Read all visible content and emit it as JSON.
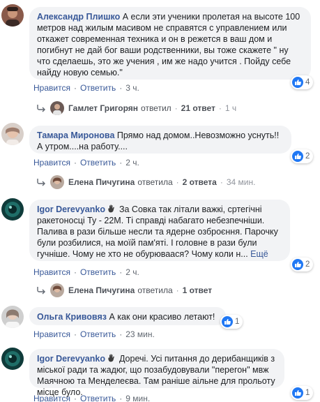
{
  "comments": [
    {
      "author": "Александр Плишко",
      "text": "А если эти ученики пролетая на высоте 100 метров над жилым масивом не справятся с управлением или откажет современная техника и он в режется в ваш дом и погибнут не дай бог ваши родственники, вы тоже скажете \" ну что сделаешь, это же учения , им же надо учится . Пойду себе найду новую семью.\"",
      "like_label": "Нравится",
      "reply_label": "Ответить",
      "time": "3 ч.",
      "reaction_count": "4",
      "replies": {
        "name": "Гамлет Григорян",
        "action": "ответил",
        "count": "21 ответ",
        "time": "1 ч"
      }
    },
    {
      "author": "Тамара Миронова",
      "text": "Прямо над домом..Невозможно уснуть!! А утром....на работу....",
      "like_label": "Нравится",
      "reply_label": "Ответить",
      "time": "2 ч.",
      "reaction_count": "2",
      "replies": {
        "name": "Елена Пичугина",
        "action": "ответила",
        "count": "2 ответа",
        "time": "34 мин."
      }
    },
    {
      "author": "Igor Derevyanko",
      "text": "За Совка так літали важкі, сртегічні ракетоносці Ту - 22М. Ті справді набагато небезпечніши. Палива в рази більше несли та ядерне озброєння. Парочку були розбилися, на моїй пам'яті. І головне в рази були гучніше. Чому не хто не обурюваася? Чому коли н...",
      "more": "Ещё",
      "like_label": "Нравится",
      "reply_label": "Ответить",
      "time": "2 ч.",
      "reaction_count": "2",
      "replies": {
        "name": "Елена Пичугина",
        "action": "ответила",
        "count": "1 ответ",
        "time": ""
      }
    },
    {
      "author": "Ольга Кривовяз",
      "text": "А как они красиво летают!",
      "like_label": "Нравится",
      "reply_label": "Ответить",
      "time": "23 мин.",
      "reaction_count": "1"
    },
    {
      "author": "Igor Derevyanko",
      "text": "Доречі. Усі питання до дерибанщиків з міської ради та жадюг, що позабудовували \"перегон\" мвж Маячною та Менделеєва. Там раніше аільне для прольоту місце було.",
      "like_label": "Нравится",
      "reply_label": "Ответить",
      "time": "9 мин.",
      "reaction_count": "1"
    }
  ],
  "colors": {
    "link": "#385898",
    "bubble": "#f2f3f5",
    "like": "#2078f4"
  }
}
